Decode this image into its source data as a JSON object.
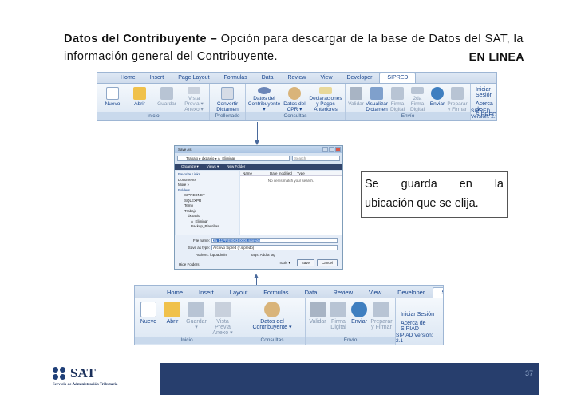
{
  "title": {
    "bold": "Datos del Contribuyente –",
    "rest": " Opción para descargar de la base de Datos del SAT, la información general del Contribuyente.",
    "online": "EN LINEA"
  },
  "callout": {
    "line1": "Se guarda en la",
    "line2": "ubicación que se elija."
  },
  "ribbon1": {
    "tabs": [
      "Home",
      "Insert",
      "Page Layout",
      "Formulas",
      "Data",
      "Review",
      "View",
      "Developer",
      "SIPRED"
    ],
    "active_tab": "SIPRED",
    "groups": [
      {
        "label": "Inicio",
        "buttons": [
          "Nuevo",
          "Abrir",
          "Guardar",
          "Vista Previa ▾",
          "Anexo ▾"
        ]
      },
      {
        "label": "Prellenado",
        "buttons": [
          "Convertir Dictamen"
        ]
      },
      {
        "label": "Consultas",
        "buttons": [
          "Datos del Contribuyente ▾",
          "Datos del CPR ▾",
          "Declaraciones y Pagos Anteriores"
        ]
      },
      {
        "label": "Envío",
        "buttons": [
          "Validar",
          "Visualizar Dictamen",
          "Firma Digital",
          "2da Firma Digital",
          "Enviar",
          "Preparar y Firmar"
        ]
      }
    ],
    "side": [
      "Iniciar Sesión",
      "Acerca de SIPRED"
    ],
    "version": "SIPRED Versión: 2.1"
  },
  "ribbon2": {
    "tabs": [
      "Home",
      "Insert",
      "Page Layout",
      "Formulas",
      "Data",
      "Review",
      "View",
      "Developer",
      "SIPIAD"
    ],
    "active_tab": "SIPIAD",
    "groups": [
      {
        "label": "Inicio",
        "buttons": [
          "Nuevo",
          "Abrir",
          "Guardar ▾",
          "Vista Previa Anexo ▾"
        ]
      },
      {
        "label": "Consultas",
        "buttons": [
          "Datos del Contribuyente ▾"
        ]
      },
      {
        "label": "Envío",
        "buttons": [
          "Validar",
          "Firma Digital",
          "Enviar",
          "Preparar y Firmar"
        ]
      }
    ],
    "side": [
      "Iniciar Sesión",
      "Acerca de SIPIAD"
    ],
    "version": "SIPIAD Versión: 2.1"
  },
  "dialog": {
    "title": "Save As",
    "path": "Trabajo ▸ dxpaxio ▸ A_Eliminar",
    "search_placeholder": "Search",
    "toolbar": [
      "Organize ▾",
      "Views ▾",
      "New Folder"
    ],
    "nav": [
      "Favorite Links",
      "Documents",
      "More »",
      "Folders",
      "SIPREDNET",
      "SQLEXPR",
      "Temp",
      "Trabajo",
      "dxpaxio",
      "A_Eliminar",
      "Backup_Plantillas"
    ],
    "columns": [
      "Name",
      "Date modified",
      "Type"
    ],
    "empty_msg": "No items match your search.",
    "file_name_label": "File name:",
    "file_name_value": "2a_11PRE9003-0008.sipredo",
    "save_type_label": "Save as type:",
    "save_type_value": "Archivo Sipred (*.sipredo)",
    "authors": "Authors: fuppadmin",
    "tags": "Tags: Add a tag",
    "tools": "Tools ▾",
    "save": "Save",
    "cancel": "Cancel",
    "hide": "Hide Folders"
  },
  "footer": {
    "page": "37",
    "logo": "SAT",
    "logo_sub": "Servicio de Administración Tributaria"
  },
  "colors": {
    "accent": "#273e6d",
    "ribbon": "#e6eef8"
  }
}
